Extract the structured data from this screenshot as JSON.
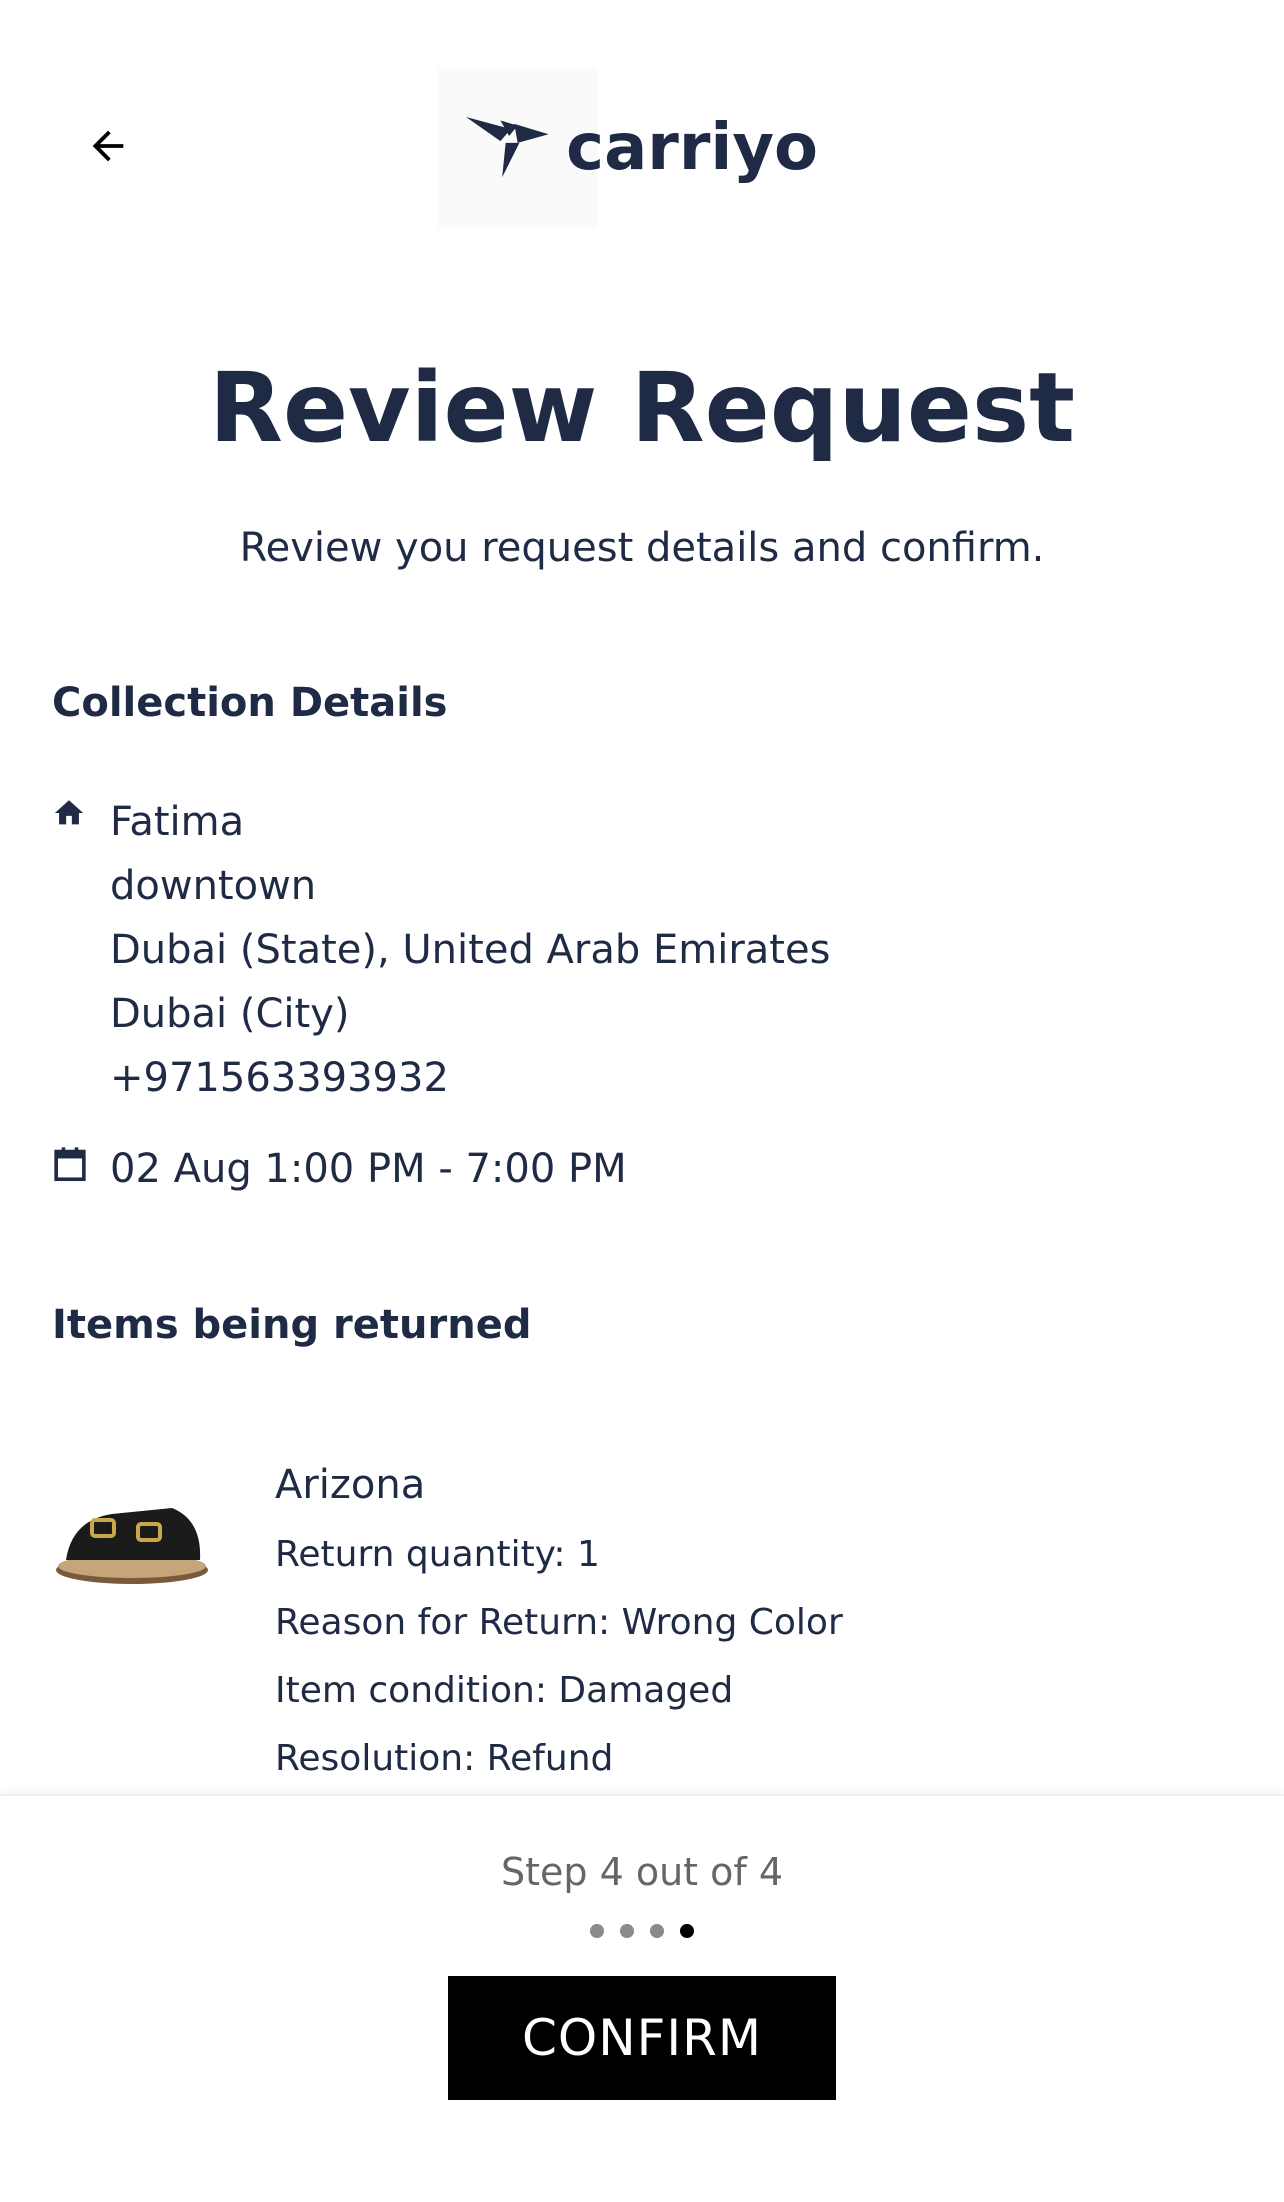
{
  "header": {
    "back_icon": "arrow-left-icon",
    "logo_text": "carriyo"
  },
  "page": {
    "title": "Review Request",
    "subtitle": "Review you request details and confirm."
  },
  "collection": {
    "heading": "Collection Details",
    "address_icon": "home-icon",
    "name": "Fatima",
    "street": "downtown",
    "region": "Dubai (State), United Arab Emirates",
    "city": "Dubai (City)",
    "phone": "+971563393932",
    "slot_icon": "calendar-icon",
    "slot": "02 Aug 1:00 PM - 7:00 PM"
  },
  "items": {
    "heading": "Items being returned",
    "list": [
      {
        "name": "Arizona",
        "quantity": "Return quantity: 1",
        "reason": "Reason for Return: Wrong Color",
        "condition": "Item condition: Damaged",
        "resolution": "Resolution: Refund"
      }
    ]
  },
  "footer": {
    "step_text": "Step 4 out of 4",
    "total_steps": 4,
    "current_step": 4,
    "confirm_label": "CONFIRM"
  },
  "colors": {
    "text_primary": "#1f2b44",
    "button_bg": "#000000",
    "button_text": "#ffffff"
  }
}
